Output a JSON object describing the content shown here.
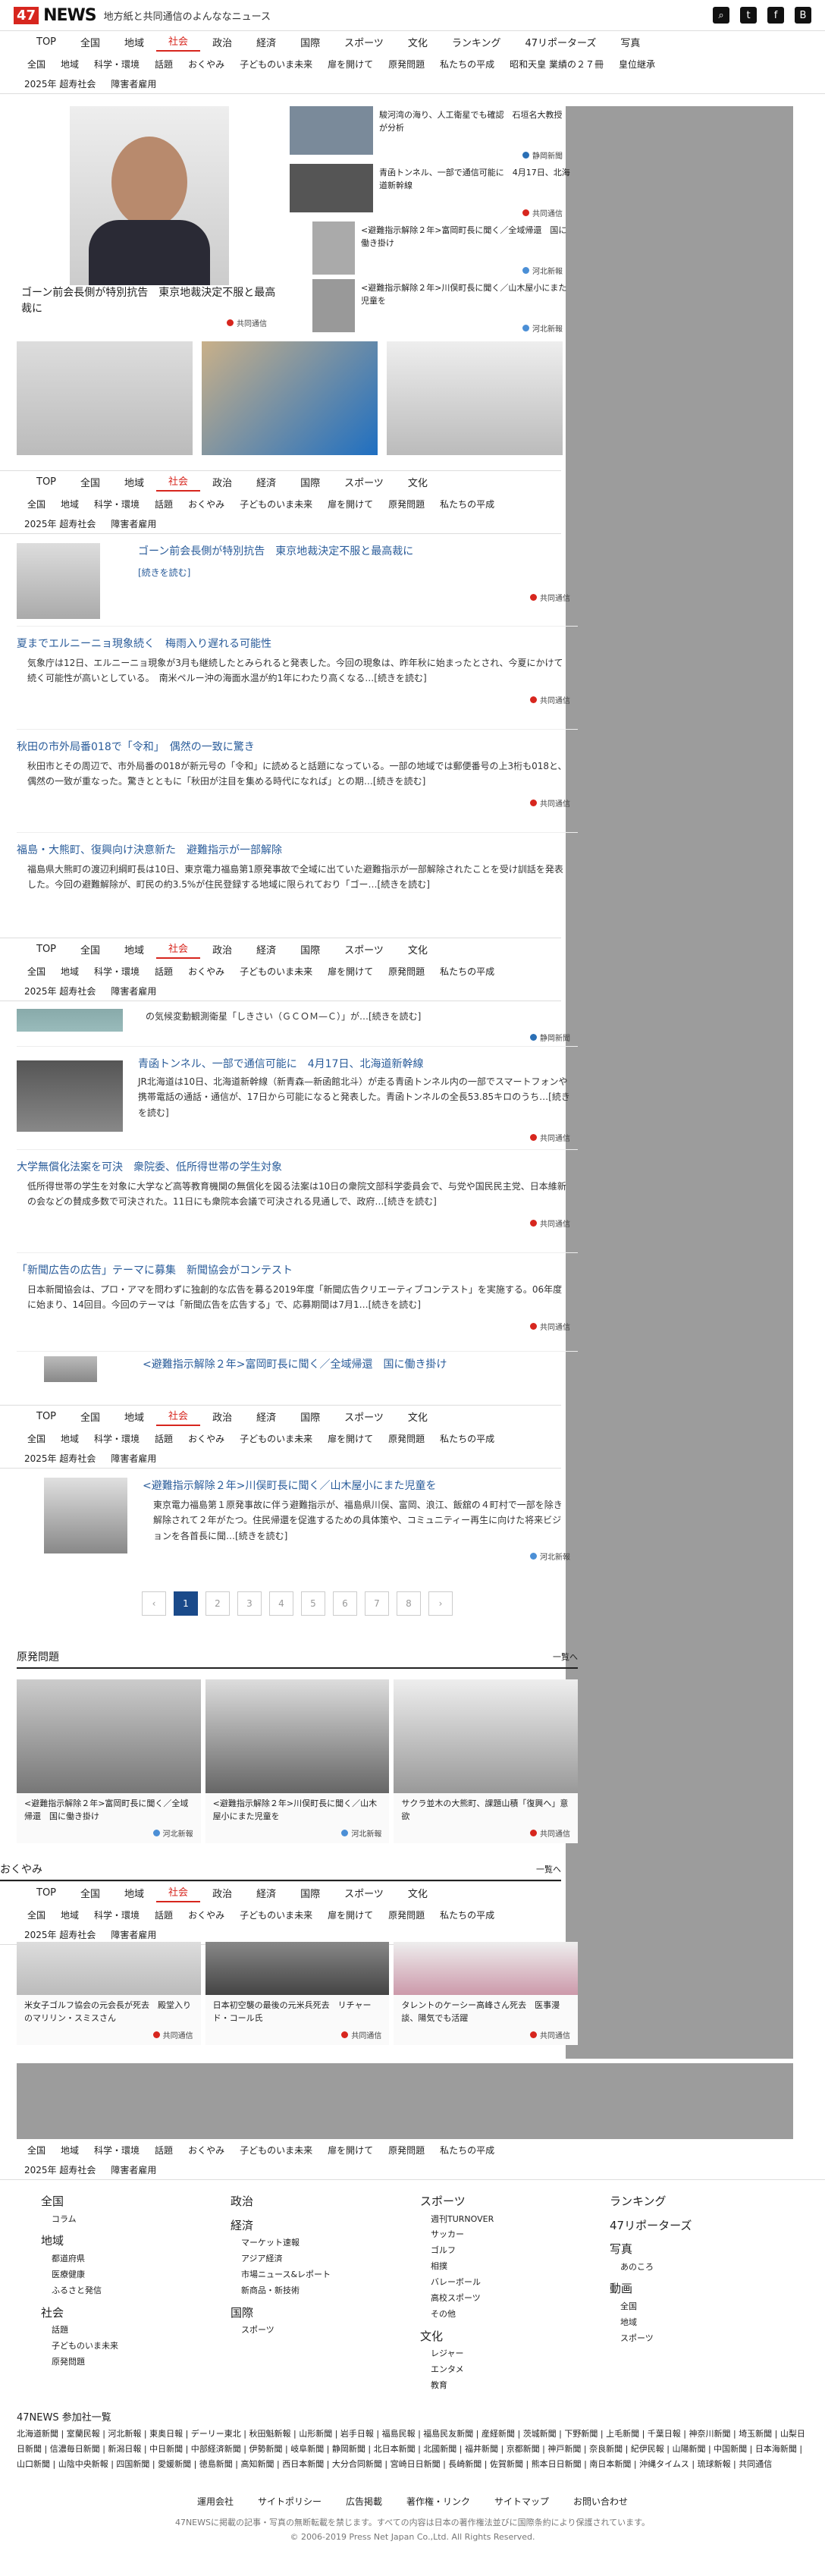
{
  "header": {
    "logo_num": "47",
    "logo_text": "NEWS",
    "tagline": "地方紙と共同通信のよんななニュース",
    "icons": [
      "search-icon",
      "twitter-icon",
      "facebook-icon",
      "bookmark-icon"
    ]
  },
  "nav": {
    "primary": [
      "TOP",
      "全国",
      "地域",
      "社会",
      "政治",
      "経済",
      "国際",
      "スポーツ",
      "文化",
      "ランキング",
      "47リポーターズ",
      "写真"
    ],
    "secondary": [
      "全国",
      "地域",
      "科学・環境",
      "話題",
      "おくやみ",
      "子どものいま未来",
      "扉を開けて",
      "原発問題",
      "私たちの平成",
      "昭和天皇 業績の２７冊",
      "皇位継承"
    ],
    "tertiary": [
      "2025年 超寿社会",
      "障害者雇用"
    ]
  },
  "top_feature": {
    "main_title": "ゴーン前会長側が特別抗告　東京地裁決定不服と最高裁に",
    "main_source": "共同通信",
    "side_items": [
      {
        "title": "駿河湾の海り、人工衛星でも確認　石垣名大教授が分析",
        "source": "静岡新聞"
      },
      {
        "title": "青函トンネル、一部で通信可能に　4月17日、北海道新幹線",
        "source": "共同通信"
      },
      {
        "title": "<避難指示解除２年>富岡町長に聞く／全域帰還　国に働き掛け",
        "source": "河北新報"
      },
      {
        "title": "<避難指示解除２年>川俣町長に聞く／山木屋小にまた児童を",
        "source": "河北新報"
      }
    ]
  },
  "articles": [
    {
      "title": "ゴーン前会長側が特別抗告　東京地裁決定不服と最高裁に",
      "body": "[続きを読む]",
      "source": "共同通信"
    },
    {
      "title": "夏までエルニーニョ現象続く　梅雨入り遅れる可能性",
      "body": "気象庁は12日、エルニーニョ現象が3月も継続したとみられると発表した。今回の現象は、昨年秋に始まったとされ、今夏にかけて続く可能性が高いとしている。　南米ペルー沖の海面水温が約1年にわたり高くなる…[続きを読む]",
      "source": "共同通信"
    },
    {
      "title": "秋田の市外局番018で「令和」　偶然の一致に驚き",
      "body": "秋田市とその周辺で、市外局番の018が新元号の「令和」に読めると話題になっている。一部の地域では郵便番号の上3桁も018と、偶然の一致が重なった。驚きとともに「秋田が注目を集める時代になれば」との期…[続きを読む]",
      "source": "共同通信"
    },
    {
      "title": "福島・大熊町、復興向け決意新た　避難指示が一部解除",
      "body": "福島県大熊町の渡辺利綱町長は10日、東京電力福島第1原発事故で全域に出ていた避難指示が一部解除されたことを受け訓話を発表した。今回の避難解除が、町民の約3.5%が住民登録する地域に限られており「ゴー…[続きを読む]",
      "source": "共同通信"
    },
    {
      "title": "",
      "body": "の気候変動観測衛星「しきさい（ＧＣＯＭ—Ｃ）」が…[続きを読む]",
      "source": "静岡新聞"
    },
    {
      "title": "青函トンネル、一部で通信可能に　4月17日、北海道新幹線",
      "body": "JR北海道は10日、北海道新幹線（新青森—新函館北斗）が走る青函トンネル内の一部でスマートフォンや携帯電話の通話・通信が、17日から可能になると発表した。青函トンネルの全長53.85キロのうち…[続きを読む]",
      "source": "共同通信"
    },
    {
      "title": "大学無償化法案を可決　衆院委、低所得世帯の学生対象",
      "body": "低所得世帯の学生を対象に大学など高等教育機関の無償化を図る法案は10日の衆院文部科学委員会で、与党や国民民主党、日本維新の会などの賛成多数で可決された。11日にも衆院本会議で可決される見通しで、政府…[続きを読む]",
      "source": "共同通信"
    },
    {
      "title": "「新聞広告の広告」テーマに募集　新聞協会がコンテスト",
      "body": "日本新聞協会は、プロ・アマを問わずに独創的な広告を募る2019年度「新聞広告クリエーティブコンテスト」を実施する。06年度に始まり、14回目。今回のテーマは「新聞広告を広告する」で、応募期間は7月1…[続きを読む]",
      "source": "共同通信"
    },
    {
      "title": "<避難指示解除２年>富岡町長に聞く／全域帰還　国に働き掛け",
      "body": "東京電力福島第１原発事故に伴う避難指示",
      "source": "河北新報"
    },
    {
      "title": "<避難指示解除２年>川俣町長に聞く／山木屋小にまた児童を",
      "body": "東京電力福島第１原発事故に伴う避難指示が、福島県川俣、富岡、浪江、飯舘の４町村で一部を除き解除されて２年がたつ。住民帰還を促進するための具体策や、コミュニティー再生に向けた将来ビジョンを各首長に聞…[続きを読む]",
      "source": "河北新報"
    }
  ],
  "pager": [
    "‹",
    "1",
    "2",
    "3",
    "4",
    "5",
    "6",
    "7",
    "8",
    "›"
  ],
  "genpatsu": {
    "heading": "原発問題",
    "more": "一覧へ",
    "cards": [
      {
        "title": "<避難指示解除２年>富岡町長に聞く／全域帰還　国に働き掛け",
        "source": "河北新報"
      },
      {
        "title": "<避難指示解除２年>川俣町長に聞く／山木屋小にまた児童を",
        "source": "河北新報"
      },
      {
        "title": "サクラ並木の大熊町、課題山積「復興へ」意欲",
        "source": "共同通信"
      }
    ]
  },
  "okuyami": {
    "heading": "おくやみ",
    "more": "一覧へ",
    "cards": [
      {
        "title": "米女子ゴルフ協会の元会長が死去　殿堂入りのマリリン・スミスさん",
        "source": "共同通信"
      },
      {
        "title": "日本初空襲の最後の元米兵死去　リチャード・コール氏",
        "source": "共同通信"
      },
      {
        "title": "タレントのケーシー高峰さん死去　医事漫談、陽気でも活躍",
        "source": "共同通信"
      }
    ]
  },
  "footer": {
    "cols": [
      {
        "items": [
          {
            "h": "全国",
            "sub": [
              "コラム"
            ]
          },
          {
            "h": "地域",
            "sub": [
              "都道府県",
              "医療健康",
              "ふるさと発信"
            ]
          },
          {
            "h": "社会",
            "sub": [
              "話題",
              "子どものいま未来",
              "原発問題"
            ]
          }
        ]
      },
      {
        "items": [
          {
            "h": "政治",
            "sub": []
          },
          {
            "h": "経済",
            "sub": [
              "マーケット速報",
              "アジア経済",
              "市場ニュース&レポート",
              "新商品・新技術"
            ]
          },
          {
            "h": "国際",
            "sub": [
              "スポーツ"
            ]
          }
        ]
      },
      {
        "items": [
          {
            "h": "スポーツ",
            "sub": [
              "週刊TURNOVER",
              "サッカー",
              "ゴルフ",
              "相撲",
              "バレーボール",
              "高校スポーツ",
              "その他"
            ]
          },
          {
            "h": "文化",
            "sub": [
              "レジャー",
              "エンタメ",
              "教育"
            ]
          }
        ]
      },
      {
        "items": [
          {
            "h": "ランキング",
            "sub": []
          },
          {
            "h": "47リポーターズ",
            "sub": []
          },
          {
            "h": "写真",
            "sub": [
              "あのころ"
            ]
          },
          {
            "h": "動画",
            "sub": [
              "全国",
              "地域",
              "スポーツ"
            ]
          }
        ]
      }
    ],
    "papers_heading": "47NEWS 参加社一覧",
    "papers": "北海道新聞 | 室蘭民報 | 河北新報 | 東奥日報 | デーリー東北 | 秋田魁新報 | 山形新聞 | 岩手日報 | 福島民報 | 福島民友新聞 | 産経新聞 | 茨城新聞 | 下野新聞 | 上毛新聞 | 千葉日報 | 神奈川新聞 | 埼玉新聞 | 山梨日日新聞 | 信濃毎日新聞 | 新潟日報 | 中日新聞 | 中部経済新聞 | 伊勢新聞 | 岐阜新聞 | 静岡新聞 | 北日本新聞 | 北國新聞 | 福井新聞 | 京都新聞 | 神戸新聞 | 奈良新聞 | 紀伊民報 | 山陽新聞 | 中国新聞 | 日本海新聞 | 山口新聞 | 山陰中央新報 | 四国新聞 | 愛媛新聞 | 徳島新聞 | 高知新聞 | 西日本新聞 | 大分合同新聞 | 宮崎日日新聞 | 長崎新聞 | 佐賀新聞 | 熊本日日新聞 | 南日本新聞 | 沖縄タイムス | 琉球新報 | 共同通信",
    "links": [
      "運用会社",
      "サイトポリシー",
      "広告掲載",
      "著作権・リンク",
      "サイトマップ",
      "お問い合わせ"
    ],
    "notice": "47NEWSに掲載の記事・写真の無断転載を禁じます。すべての内容は日本の著作権法並びに国際条約により保護されています。",
    "copyright": "© 2006-2019 Press Net Japan Co.,Ltd. All Rights Reserved."
  }
}
